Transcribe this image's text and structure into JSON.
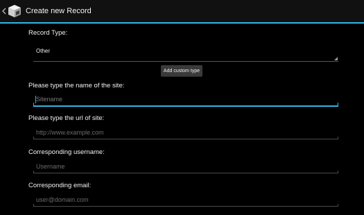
{
  "header": {
    "title": "Create new Record",
    "accent_color": "#33b5e5",
    "icon": "cube-app-icon"
  },
  "form": {
    "record_type_label": "Record Type:",
    "record_type_value": "Other",
    "add_custom_type_label": "Add custom type",
    "site_name_label": "Please type the name of the site:",
    "site_name_placeholder": "Sitename",
    "site_url_label": "Please type the url of site:",
    "site_url_placeholder": "http://www.example.com",
    "username_label": "Corresponding username:",
    "username_placeholder": "Username",
    "email_label": "Corresponding email:",
    "email_placeholder": "user@domain.com"
  }
}
